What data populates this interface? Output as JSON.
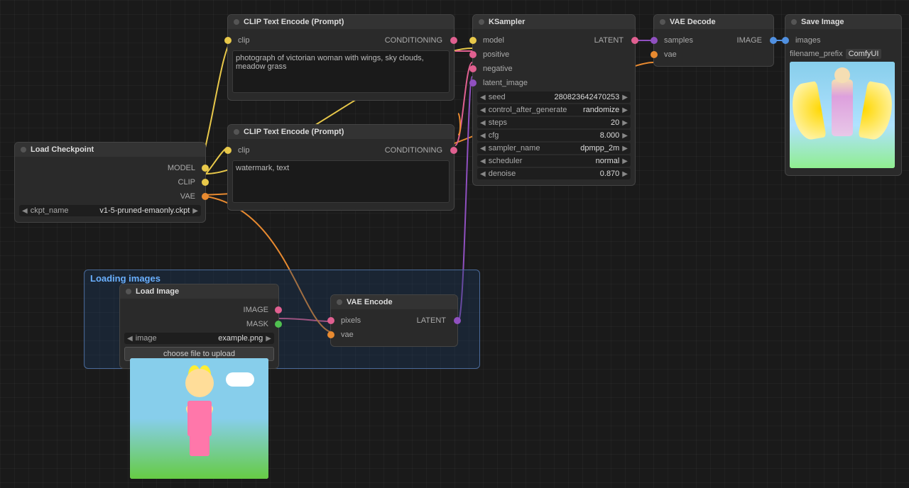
{
  "nodes": {
    "load_checkpoint": {
      "title": "Load Checkpoint",
      "outputs": [
        "MODEL",
        "CLIP",
        "VAE"
      ],
      "ckpt_field_label": "ckpt_name",
      "ckpt_value": "v1-5-pruned-emaonly.ckpt"
    },
    "clip_top": {
      "title": "CLIP Text Encode (Prompt)",
      "port_label": "clip",
      "output_label": "CONDITIONING",
      "text": "photograph of victorian woman with wings, sky clouds, meadow grass"
    },
    "clip_bottom": {
      "title": "CLIP Text Encode (Prompt)",
      "port_label": "clip",
      "output_label": "CONDITIONING",
      "text": "watermark, text"
    },
    "ksampler": {
      "title": "KSampler",
      "inputs": [
        "model",
        "positive",
        "negative",
        "latent_image"
      ],
      "output_label": "LATENT",
      "fields": [
        {
          "label": "seed",
          "value": "280823642470253"
        },
        {
          "label": "control_after_generate",
          "value": "randomize"
        },
        {
          "label": "steps",
          "value": "20"
        },
        {
          "label": "cfg",
          "value": "8.000"
        },
        {
          "label": "sampler_name",
          "value": "dpmpp_2m"
        },
        {
          "label": "scheduler",
          "value": "normal"
        },
        {
          "label": "denoise",
          "value": "0.870"
        }
      ]
    },
    "vae_decode": {
      "title": "VAE Decode",
      "inputs": [
        "samples",
        "vae"
      ],
      "output_label": "IMAGE"
    },
    "save_image": {
      "title": "Save Image",
      "inputs": [
        "images"
      ],
      "filename_prefix_label": "filename_prefix",
      "filename_prefix_value": "ComfyUI"
    },
    "load_image": {
      "title": "Load Image",
      "outputs": [
        "IMAGE",
        "MASK"
      ],
      "field_label": "image",
      "field_value": "example.png"
    },
    "vae_encode": {
      "title": "VAE Encode",
      "inputs": [
        "pixels",
        "vae"
      ],
      "output_label": "LATENT"
    }
  },
  "groups": {
    "loading_images": {
      "title": "Loading images"
    }
  },
  "buttons": {
    "choose_file": "choose file to upload"
  }
}
